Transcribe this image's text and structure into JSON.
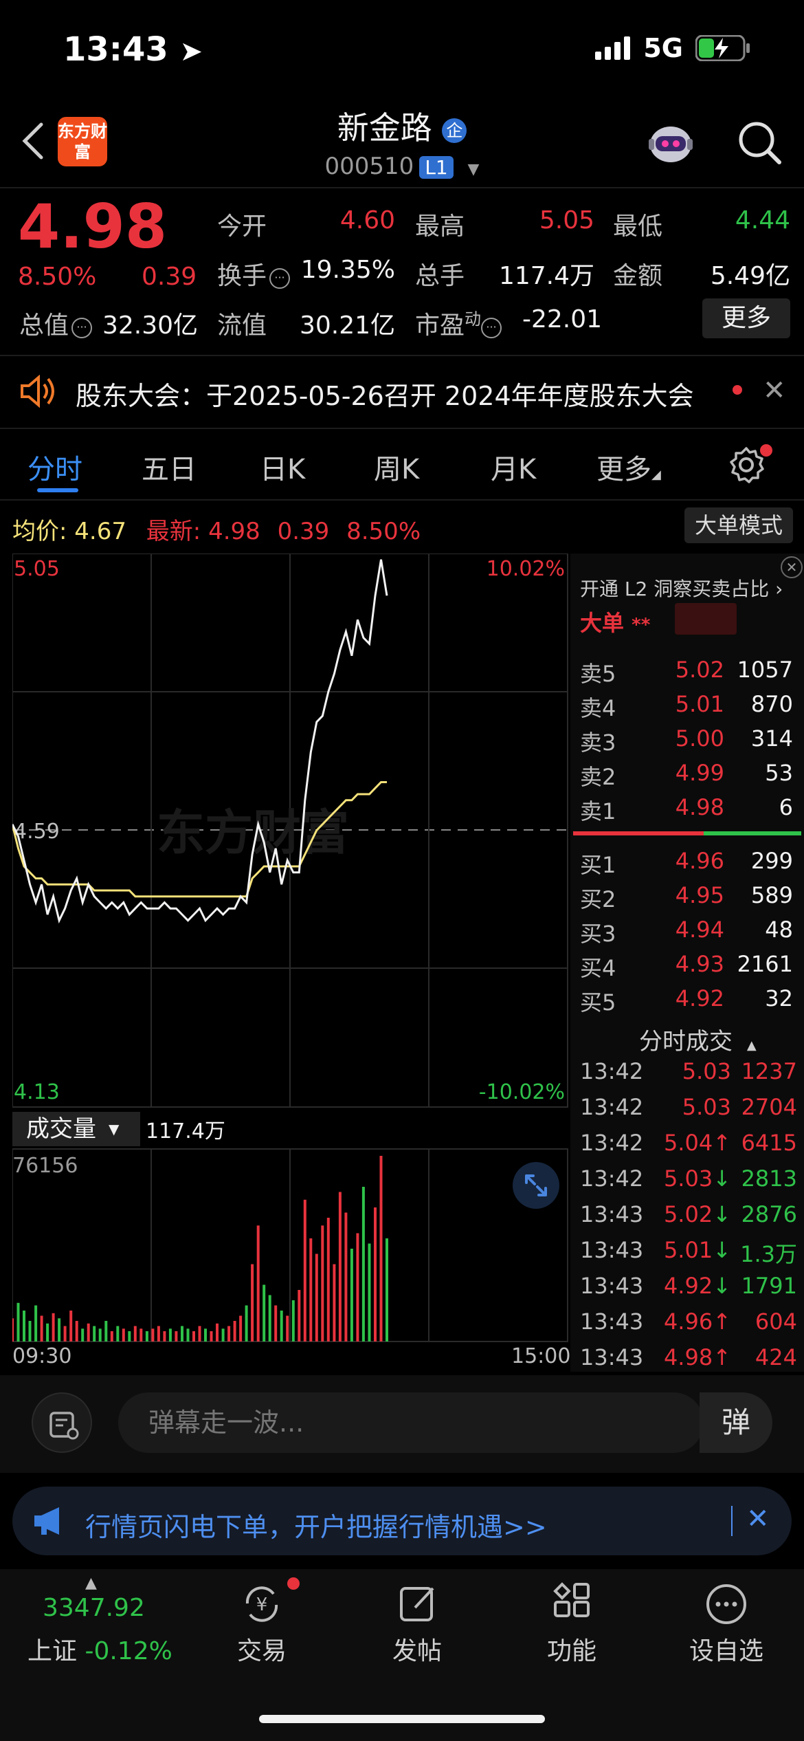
{
  "status": {
    "time": "13:43",
    "network": "5G"
  },
  "header": {
    "logo": "东方财富",
    "stock_name": "新金路",
    "badge": "企",
    "code": "000510",
    "level": "L1"
  },
  "quote": {
    "price": "4.98",
    "pct": "8.50%",
    "change": "0.39",
    "open_label": "今开",
    "open": "4.60",
    "high_label": "最高",
    "high": "5.05",
    "low_label": "最低",
    "low": "4.44",
    "turnover_label": "换手",
    "turnover": "19.35%",
    "volume_label": "总手",
    "volume": "117.4万",
    "amount_label": "金额",
    "amount": "5.49亿",
    "mktcap_label": "总值",
    "mktcap": "32.30亿",
    "float_label": "流值",
    "float": "30.21亿",
    "pe_label": "市盈",
    "pe_sup": "动",
    "pe": "-22.01",
    "more": "更多"
  },
  "notice": {
    "text": "股东大会：于2025-05-26召开 2024年年度股东大会"
  },
  "tabs": [
    "分时",
    "五日",
    "日K",
    "周K",
    "月K",
    "更多"
  ],
  "avg": {
    "label": "均价:",
    "value": "4.67",
    "latest_label": "最新:",
    "latest": "4.98",
    "chg": "0.39",
    "pct": "8.50%",
    "mode_btn": "大单模式"
  },
  "chart_data": {
    "type": "line",
    "y_top": "5.05",
    "y_mid": "4.59",
    "y_bottom": "4.13",
    "pct_top": "10.02%",
    "pct_bottom": "-10.02%",
    "x_start": "09:30",
    "x_end": "15:00",
    "ylim": [
      4.13,
      5.05
    ],
    "series": [
      {
        "name": "price",
        "values": [
          4.6,
          4.58,
          4.54,
          4.5,
          4.47,
          4.5,
          4.45,
          4.48,
          4.44,
          4.46,
          4.49,
          4.51,
          4.47,
          4.5,
          4.48,
          4.47,
          4.46,
          4.47,
          4.46,
          4.47,
          4.45,
          4.46,
          4.47,
          4.46,
          4.46,
          4.46,
          4.47,
          4.46,
          4.46,
          4.45,
          4.44,
          4.45,
          4.46,
          4.44,
          4.45,
          4.46,
          4.45,
          4.46,
          4.46,
          4.48,
          4.47,
          4.55,
          4.6,
          4.57,
          4.52,
          4.56,
          4.5,
          4.54,
          4.52,
          4.52,
          4.64,
          4.72,
          4.77,
          4.78,
          4.82,
          4.85,
          4.89,
          4.92,
          4.88,
          4.94,
          4.91,
          4.9,
          4.98,
          5.04,
          4.98
        ]
      },
      {
        "name": "avg",
        "values": [
          4.6,
          4.56,
          4.53,
          4.52,
          4.51,
          4.51,
          4.5,
          4.5,
          4.5,
          4.5,
          4.5,
          4.5,
          4.5,
          4.5,
          4.49,
          4.49,
          4.49,
          4.49,
          4.49,
          4.49,
          4.49,
          4.48,
          4.48,
          4.48,
          4.48,
          4.48,
          4.48,
          4.48,
          4.48,
          4.48,
          4.48,
          4.48,
          4.48,
          4.48,
          4.48,
          4.48,
          4.48,
          4.48,
          4.48,
          4.48,
          4.48,
          4.51,
          4.52,
          4.53,
          4.53,
          4.53,
          4.53,
          4.53,
          4.53,
          4.53,
          4.55,
          4.57,
          4.59,
          4.6,
          4.61,
          4.62,
          4.63,
          4.64,
          4.64,
          4.65,
          4.65,
          4.65,
          4.66,
          4.67,
          4.67
        ]
      }
    ],
    "volume_label": "成交量",
    "volume_total": "117.4万",
    "volume_max": "76156",
    "volume": [
      9,
      15,
      12,
      8,
      14,
      10,
      7,
      11,
      9,
      6,
      12,
      8,
      5,
      7,
      6,
      5,
      8,
      4,
      6,
      5,
      4,
      6,
      5,
      4,
      5,
      6,
      4,
      5,
      4,
      6,
      5,
      4,
      6,
      5,
      4,
      7,
      5,
      6,
      8,
      10,
      14,
      30,
      45,
      22,
      18,
      14,
      12,
      10,
      16,
      20,
      55,
      40,
      34,
      45,
      48,
      30,
      58,
      50,
      36,
      42,
      60,
      38,
      52,
      72,
      40
    ]
  },
  "order_book": {
    "l2_text": "开通 L2 洞察买卖占比",
    "big_label": "大单",
    "asks": [
      {
        "label": "卖5",
        "price": "5.02",
        "vol": "1057"
      },
      {
        "label": "卖4",
        "price": "5.01",
        "vol": "870"
      },
      {
        "label": "卖3",
        "price": "5.00",
        "vol": "314"
      },
      {
        "label": "卖2",
        "price": "4.99",
        "vol": "53"
      },
      {
        "label": "卖1",
        "price": "4.98",
        "vol": "6"
      }
    ],
    "bids": [
      {
        "label": "买1",
        "price": "4.96",
        "vol": "299"
      },
      {
        "label": "买2",
        "price": "4.95",
        "vol": "589"
      },
      {
        "label": "买3",
        "price": "4.94",
        "vol": "48"
      },
      {
        "label": "买4",
        "price": "4.93",
        "vol": "2161"
      },
      {
        "label": "买5",
        "price": "4.92",
        "vol": "32"
      }
    ],
    "trades_title": "分时成交",
    "trades": [
      {
        "time": "13:42",
        "price": "5.03",
        "arrow": "",
        "vol": "1237",
        "color": "red"
      },
      {
        "time": "13:42",
        "price": "5.03",
        "arrow": "",
        "vol": "2704",
        "color": "red"
      },
      {
        "time": "13:42",
        "price": "5.04",
        "arrow": "↑",
        "vol": "6415",
        "color": "red"
      },
      {
        "time": "13:42",
        "price": "5.03",
        "arrow": "↓",
        "vol": "2813",
        "color": "green"
      },
      {
        "time": "13:43",
        "price": "5.02",
        "arrow": "↓",
        "vol": "2876",
        "color": "green"
      },
      {
        "time": "13:43",
        "price": "5.01",
        "arrow": "↓",
        "vol": "1.3万",
        "color": "green"
      },
      {
        "time": "13:43",
        "price": "4.92",
        "arrow": "↓",
        "vol": "1791",
        "color": "green"
      },
      {
        "time": "13:43",
        "price": "4.96",
        "arrow": "↑",
        "vol": "604",
        "color": "red"
      },
      {
        "time": "13:43",
        "price": "4.98",
        "arrow": "↑",
        "vol": "424",
        "color": "red"
      }
    ]
  },
  "comment": {
    "placeholder": "弹幕走一波...",
    "danmu": "弹"
  },
  "ad": {
    "text": "行情页闪电下单，开户把握行情机遇>>"
  },
  "bottom": {
    "index_value": "3347.92",
    "index_name": "上证",
    "index_chg": "-0.12%",
    "items": [
      "交易",
      "发帖",
      "功能",
      "设自选"
    ]
  },
  "colors": {
    "up": "#e8333d",
    "down": "#2fc24a",
    "avg": "#f5e27a",
    "accent": "#2f7ff0"
  }
}
